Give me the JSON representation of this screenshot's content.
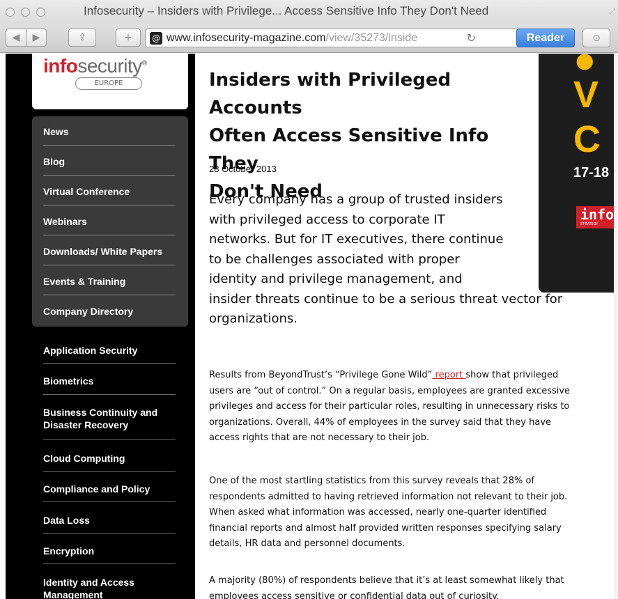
{
  "window": {
    "title": "Infosecurity – Insiders with Privilege... Access Sensitive Info They Don't Need",
    "url_domain": "www.infosecurity-magazine.com",
    "url_path": "/view/35273/inside",
    "reader_label": "Reader"
  },
  "logo": {
    "part1": "info",
    "part2": "security",
    "reg": "®",
    "sub": "EUROPE"
  },
  "nav": [
    "News",
    "Blog",
    "Virtual Conference",
    "Webinars",
    "Downloads/ White Papers",
    "Events & Training",
    "Company Directory"
  ],
  "categories": [
    "Application Security",
    "Biometrics",
    "Business Continuity and Disaster Recovery",
    "Cloud Computing",
    "Compliance and Policy",
    "Data Loss",
    "Encryption",
    "Identity and Access Management"
  ],
  "ad": {
    "line1": "V",
    "line2": "C",
    "date": "17-18",
    "brand": "info",
    "brand_sub": "STRATEGY"
  },
  "article": {
    "title_lines": [
      "Insiders with Privileged Accounts",
      "Often Access Sensitive Info They",
      "Don't Need"
    ],
    "date": "28 October 2013",
    "lead_lines": [
      "Every company has a group of trusted insiders",
      "with privileged access to corporate IT",
      "networks. But for IT executives, there continue",
      "to be challenges associated with proper",
      "identity and privilege management, and",
      "insider threats continue to be a serious threat vector for",
      "organizations."
    ],
    "p1": {
      "pre": "Results from BeyondTrust’s “Privilege Gone Wild”",
      "link": " report ",
      "post": "show that privileged",
      "lines": [
        "users are “out of control.” On a regular basis, employees are granted excessive",
        "privileges and access for their particular roles, resulting in unnecessary risks to",
        "organizations. Overall, 44% of employees in the survey said that they have",
        "access rights that are not necessary to their job."
      ]
    },
    "p2_lines": [
      "One of the most startling statistics from this survey reveals that 28% of",
      "respondents admitted to having retrieved information not relevant to their job.",
      "When asked what information was accessed, nearly one-quarter identified",
      "financial reports and almost half provided written responses specifying salary",
      "details, HR data and personnel documents."
    ],
    "p3_lines": [
      "A majority (80%) of respondents believe that it’s at least somewhat likely that",
      "employees access sensitive or confidential data out of curiosity."
    ]
  }
}
